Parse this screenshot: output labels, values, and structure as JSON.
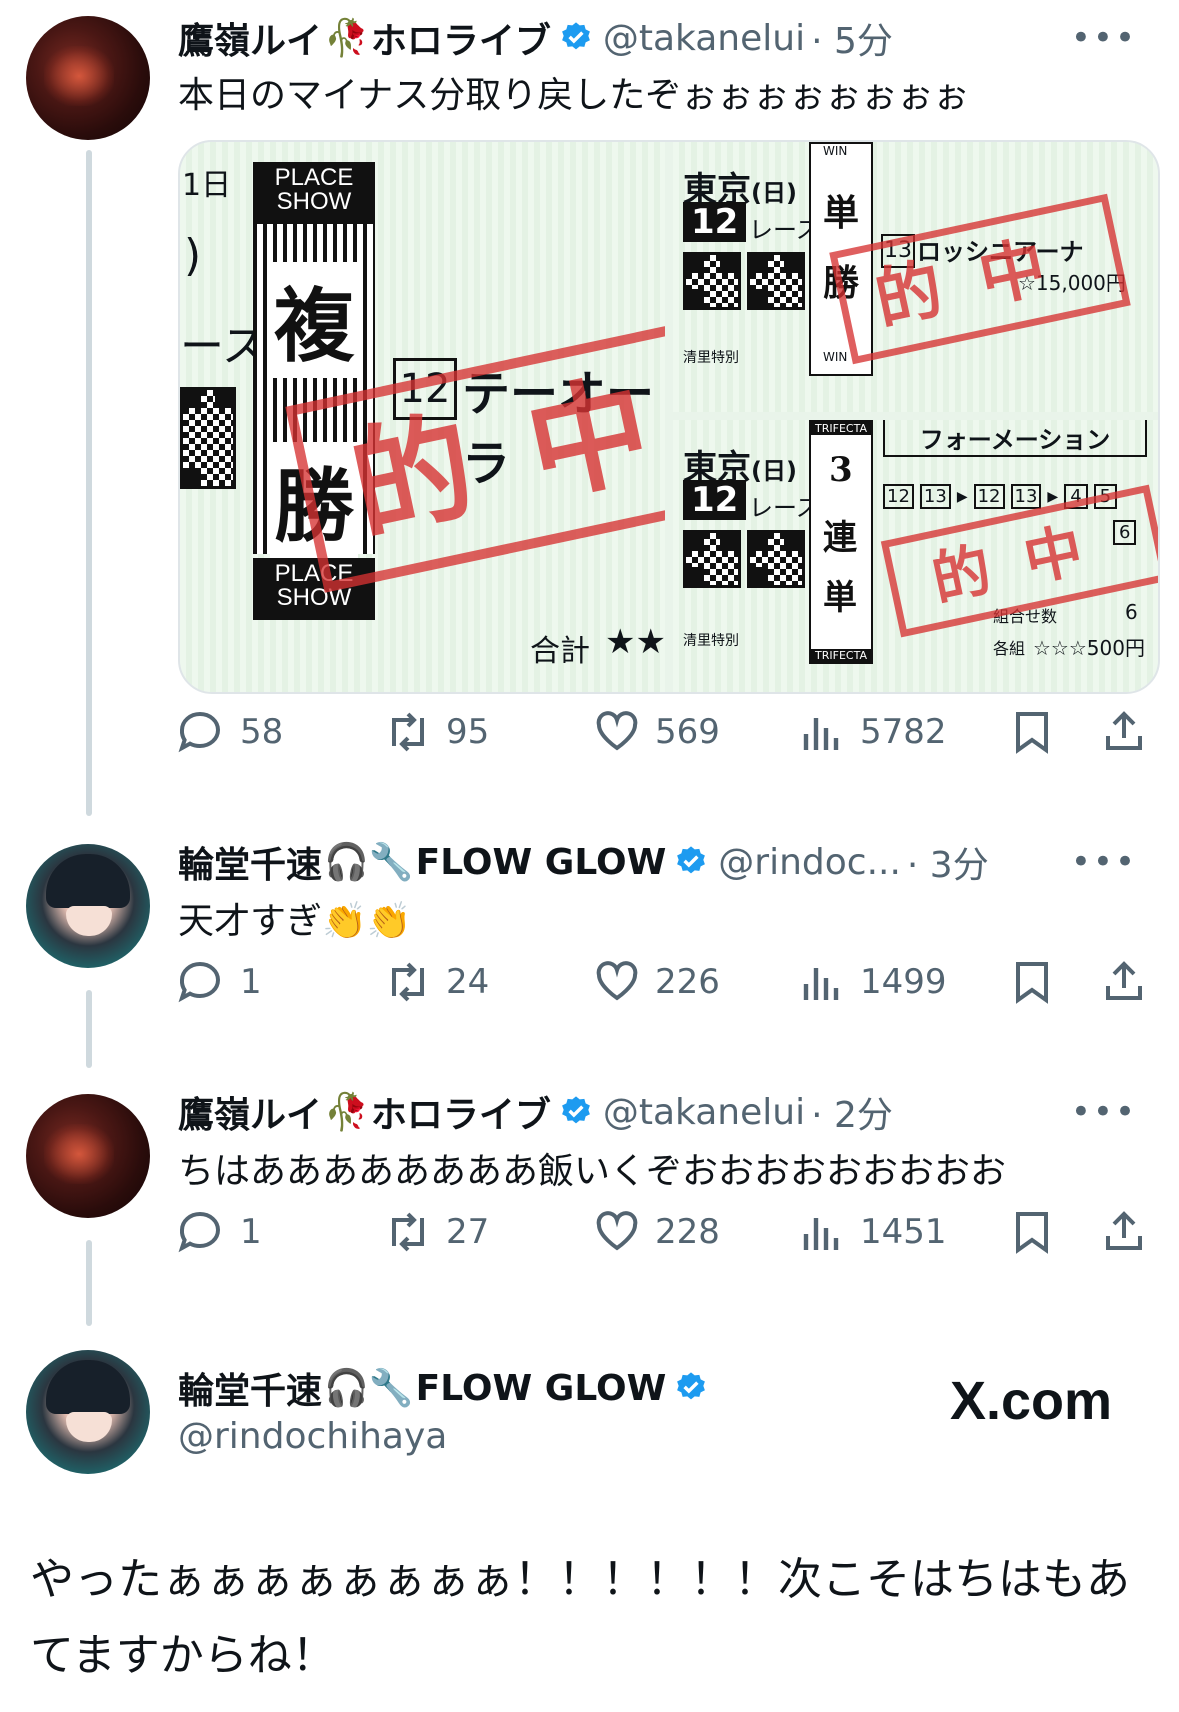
{
  "posts": [
    {
      "name": "鷹嶺ルイ",
      "emoji": "🥀",
      "name_suffix": "ホロライブ",
      "handle": "@takanelui",
      "time": "· 5分",
      "text": "本日のマイナス分取り戻したぞぉぉぉぉぉぉぉぉ",
      "replies": "58",
      "reposts": "95",
      "likes": "569",
      "views": "5782"
    },
    {
      "name": "輪堂千速",
      "emoji": "🎧🔧",
      "name_suffix": "FLOW GLOW",
      "handle": "@rindoc...",
      "time": "· 3分",
      "text": "天才すぎ👏👏",
      "replies": "1",
      "reposts": "24",
      "likes": "226",
      "views": "1499"
    },
    {
      "name": "鷹嶺ルイ",
      "emoji": "🥀",
      "name_suffix": "ホロライブ",
      "handle": "@takanelui",
      "time": "· 2分",
      "text": "ちはああああああああ飯いくぞおおおおおおおおお",
      "replies": "1",
      "reposts": "27",
      "likes": "228",
      "views": "1451"
    }
  ],
  "main_post": {
    "name": "輪堂千速",
    "emoji": "🎧🔧",
    "name_suffix": "FLOW GLOW",
    "handle": "@rindochihaya",
    "site": "X.com",
    "text": "やったぁぁぁぁぁぁぁぁ！！！！！！次こそはちはもあてますからね！"
  },
  "tickets": {
    "left": {
      "date_fragment": "1日",
      "paren": ")",
      "race_fragment": "ース",
      "place_show_top": "PLACE SHOW",
      "place_show_bottom": "PLACE SHOW",
      "bet_kanji_1": "複",
      "bet_kanji_2": "勝",
      "horse_number": "12",
      "horse_name": "テーオーラ",
      "total_label": "合計",
      "total_stars": "★★",
      "stamp": "的中"
    },
    "right_top": {
      "venue": "東京",
      "day": "(日)",
      "race_number": "12",
      "race_label": "レース",
      "win_top": "WIN",
      "win_bottom": "WIN",
      "bet_kanji_1": "単",
      "bet_kanji_2": "勝",
      "horse_number": "13",
      "horse_name": "ロッシニアーナ",
      "amount": "☆15,000円",
      "note": "清里特別",
      "stamp": "的中"
    },
    "right_bottom": {
      "venue": "東京",
      "day": "(日)",
      "race_number": "12",
      "race_label": "レース",
      "trifecta_top": "TRIFECTA",
      "trifecta_bottom": "TRIFECTA",
      "bet_kanji_1": "3",
      "bet_kanji_2": "連",
      "bet_kanji_3": "単",
      "formation": "フォーメーション",
      "nums_1": [
        "12",
        "13"
      ],
      "nums_2": [
        "12",
        "13"
      ],
      "nums_3": [
        "4",
        "5",
        "6"
      ],
      "combos_label": "組合せ数",
      "combos": "6",
      "each_label": "各組",
      "each_amount": "☆☆☆500円",
      "note": "清里特別",
      "stamp": "的中"
    }
  },
  "colors": {
    "verified": "#1d9bf0",
    "muted": "#536471",
    "stamp": "#d63232",
    "ticket_green": "#e4f2e4"
  }
}
